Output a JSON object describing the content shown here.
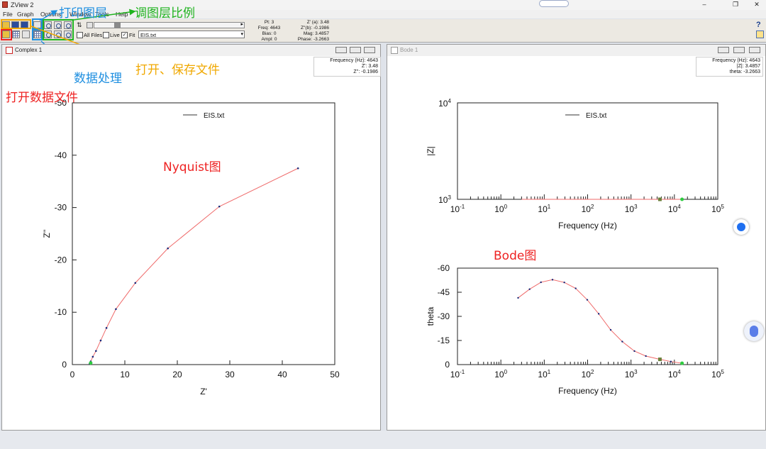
{
  "app": {
    "title": "ZView 2"
  },
  "menu": [
    "File",
    "Graph",
    "Options",
    "Window",
    "Tools",
    "Help"
  ],
  "toolbar": {
    "all_files": "All Files",
    "live": "Live",
    "fit": "Fit",
    "file_select": "EIS.txt",
    "status": {
      "pt": "Pt: 3",
      "freq": "Freq: 4643",
      "bias": "Bias: 0",
      "ampl": "Ampl: 0",
      "z1": "Z' (a): 3.48",
      "z2": "Z''(b): -0.1986",
      "mag": "Mag: 3.4857",
      "phase": "Phase: -3.2663"
    },
    "help_mark": "?"
  },
  "annotations": {
    "print_layer": "打印图层",
    "adjust_layer": "调图层比例",
    "data_processing": "数据处理",
    "open_save": "打开、保存文件",
    "open_data": "打开数据文件",
    "nyquist": "Nyquist图",
    "bode": "Bode图"
  },
  "windows": {
    "complex": {
      "title": "Complex 1",
      "readout": [
        "Frequency (Hz): 4643",
        "Z': 3.48",
        "Z'': -0.1986"
      ]
    },
    "bode": {
      "title": "Bode 1",
      "readout": [
        "Frequency (Hz): 4643",
        "|Z|: 3.4857",
        "theta: -3.2663"
      ]
    }
  },
  "colors": {
    "line": "#ef6a6a",
    "marker": "#1a2a7a",
    "selected": "#2ecc40",
    "annot_blue": "#1f8fe0",
    "annot_green": "#1fb31f",
    "annot_orange": "#f0a800",
    "annot_red": "#ee2222"
  },
  "chart_data": [
    {
      "type": "line",
      "legend": "EIS.txt",
      "xlabel": "Z'",
      "ylabel": "Z''",
      "xlim": [
        0,
        50
      ],
      "ylim": [
        -50,
        0
      ],
      "xticks": [
        "0",
        "10",
        "20",
        "30",
        "40",
        "50"
      ],
      "yticks": [
        "-50",
        "-40",
        "-30",
        "-20",
        "-10",
        "0"
      ],
      "points": [
        [
          3.3,
          -0.2
        ],
        [
          3.5,
          -0.6
        ],
        [
          3.9,
          -1.5
        ],
        [
          4.5,
          -2.6
        ],
        [
          5.4,
          -4.6
        ],
        [
          6.5,
          -7.0
        ],
        [
          8.3,
          -10.6
        ],
        [
          12.0,
          -15.6
        ],
        [
          18.2,
          -22.2
        ],
        [
          28.0,
          -30.2
        ],
        [
          43.0,
          -37.5
        ]
      ]
    },
    {
      "type": "line",
      "legend": "EIS.txt",
      "xlabel": "Frequency (Hz)",
      "ylabel": "|Z|",
      "xlog": true,
      "ylog": true,
      "xlim": [
        0.1,
        100000
      ],
      "ylim": [
        1000,
        10000
      ],
      "xticks": [
        "10-1",
        "100",
        "101",
        "102",
        "103",
        "104",
        "105"
      ],
      "yticks": [
        "104",
        "103"
      ],
      "points": [
        [
          3,
          1000
        ],
        [
          15000,
          1000
        ]
      ]
    },
    {
      "type": "line",
      "legend": "",
      "xlabel": "Frequency (Hz)",
      "ylabel": "theta",
      "xlog": true,
      "xlim": [
        0.1,
        100000
      ],
      "ylim": [
        -60,
        0
      ],
      "xticks": [
        "10-1",
        "100",
        "101",
        "102",
        "103",
        "104",
        "105"
      ],
      "yticks": [
        "-60",
        "-45",
        "-30",
        "-15",
        "0"
      ],
      "points": [
        [
          2.5,
          -41.5
        ],
        [
          4.6,
          -46.9
        ],
        [
          8.4,
          -51.2
        ],
        [
          15.5,
          -52.8
        ],
        [
          29,
          -51.1
        ],
        [
          53,
          -47.4
        ],
        [
          98,
          -40.3
        ],
        [
          180,
          -31.6
        ],
        [
          340,
          -21.6
        ],
        [
          630,
          -14.3
        ],
        [
          1200,
          -8.4
        ],
        [
          2200,
          -5.3
        ],
        [
          4643,
          -3.27
        ],
        [
          8300,
          -1.9
        ],
        [
          15000,
          -0.85
        ]
      ]
    }
  ]
}
